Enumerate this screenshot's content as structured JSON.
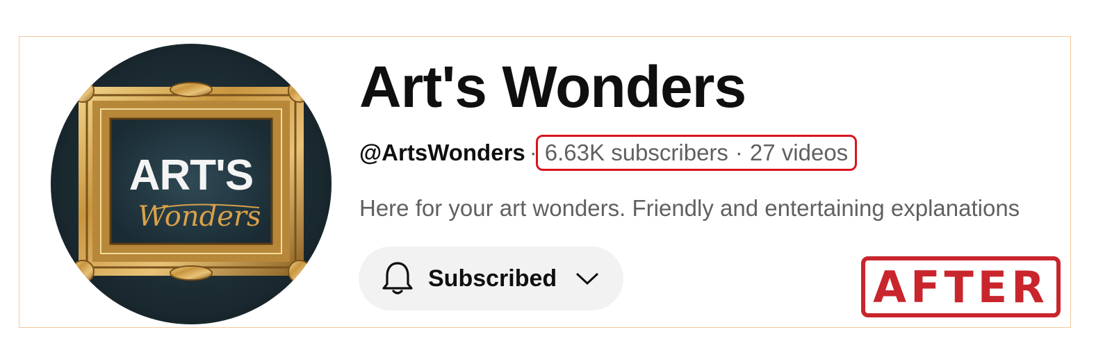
{
  "channel": {
    "name": "Art's Wonders",
    "handle": "@ArtsWonders",
    "separator": "·",
    "subscribers": "6.63K subscribers",
    "videos": "27 videos",
    "description": "Here for your art wonders. Friendly and entertaining explanations"
  },
  "subscribe_button": {
    "label": "Subscribed",
    "icon": "bell-icon",
    "menu_icon": "chevron-down-icon"
  },
  "avatar": {
    "logo_text_main": "ART'S",
    "logo_text_script": "Wonders"
  },
  "stamp": {
    "text": "AFTER"
  },
  "colors": {
    "highlight": "#d8141e",
    "stamp": "#c9252c",
    "frame_gold": "#c9963f",
    "avatar_bg": "#1b2a31",
    "secondary_text": "#606060"
  }
}
